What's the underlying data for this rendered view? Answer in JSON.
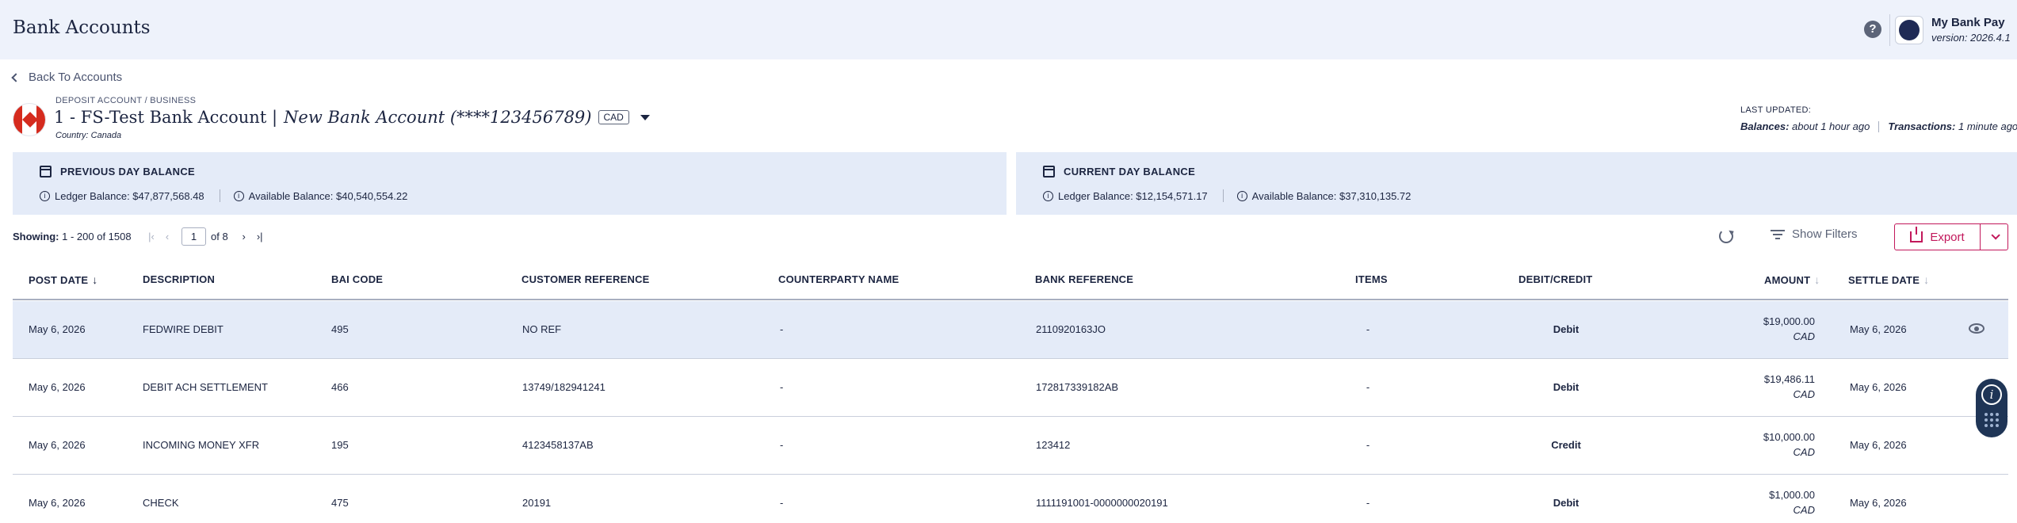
{
  "header": {
    "title": "Bank Accounts",
    "help_icon": "question-circle-icon",
    "app_name": "My Bank Pay",
    "app_version": "version: 2026.4.1"
  },
  "nav": {
    "back_label": "Back To Accounts"
  },
  "account": {
    "kicker": "DEPOSIT ACCOUNT / BUSINESS",
    "name": "1 - FS-Test Bank Account |",
    "nickname": "New Bank Account (****123456789)",
    "currency": "CAD",
    "country": "Country: Canada",
    "flag": "canada-flag-icon"
  },
  "last_updated": {
    "label": "LAST UPDATED:",
    "balances_label": "Balances:",
    "balances_value": "about 1 hour ago",
    "transactions_label": "Transactions:",
    "transactions_value": "1 minute ago"
  },
  "balances": {
    "previous": {
      "title": "PREVIOUS DAY BALANCE",
      "ledger": "Ledger Balance: $47,877,568.48",
      "available": "Available Balance: $40,540,554.22"
    },
    "current": {
      "title": "CURRENT DAY BALANCE",
      "ledger": "Ledger Balance: $12,154,571.17",
      "available": "Available Balance: $37,310,135.72"
    }
  },
  "pagination": {
    "showing_label": "Showing:",
    "showing_value": "1 - 200 of 1508",
    "page": "1",
    "of_label": "of 8"
  },
  "toolbar": {
    "filters_label": "Show Filters",
    "export_label": "Export"
  },
  "table": {
    "columns": [
      "POST DATE",
      "DESCRIPTION",
      "BAI CODE",
      "CUSTOMER REFERENCE",
      "COUNTERPARTY NAME",
      "BANK REFERENCE",
      "ITEMS",
      "DEBIT/CREDIT",
      "AMOUNT",
      "SETTLE DATE"
    ],
    "rows": [
      {
        "post_date": "May 6, 2026",
        "description": "FEDWIRE DEBIT",
        "bai": "495",
        "cust_ref": "NO REF",
        "counterparty": "-",
        "bank_ref": "2110920163JO",
        "items": "-",
        "dc": "Debit",
        "amount": "$19,000.00",
        "currency": "CAD",
        "settle_date": "May 6, 2026"
      },
      {
        "post_date": "May 6, 2026",
        "description": "DEBIT ACH SETTLEMENT",
        "bai": "466",
        "cust_ref": "13749/182941241",
        "counterparty": "-",
        "bank_ref": "172817339182AB",
        "items": "-",
        "dc": "Debit",
        "amount": "$19,486.11",
        "currency": "CAD",
        "settle_date": "May 6, 2026"
      },
      {
        "post_date": "May 6, 2026",
        "description": "INCOMING MONEY XFR",
        "bai": "195",
        "cust_ref": "4123458137AB",
        "counterparty": "-",
        "bank_ref": "123412",
        "items": "-",
        "dc": "Credit",
        "amount": "$10,000.00",
        "currency": "CAD",
        "settle_date": "May 6, 2026"
      },
      {
        "post_date": "May 6, 2026",
        "description": "CHECK",
        "bai": "475",
        "cust_ref": "20191",
        "counterparty": "-",
        "bank_ref": "1111191001-0000000020191",
        "items": "-",
        "dc": "Debit",
        "amount": "$1,000.00",
        "currency": "CAD",
        "settle_date": "May 6, 2026"
      }
    ]
  },
  "colors": {
    "accent": "#c2185b",
    "header_bg": "#eef2fb",
    "card_bg": "#e4ebf8",
    "text": "#1c2541"
  }
}
